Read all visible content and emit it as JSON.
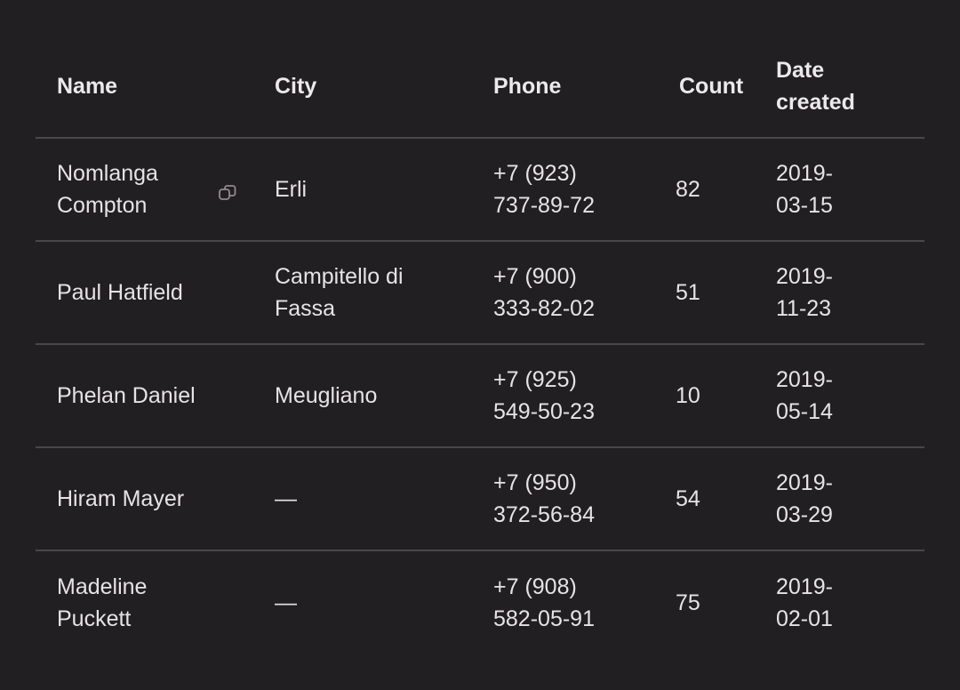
{
  "table": {
    "headers": {
      "name": "Name",
      "city": "City",
      "phone": "Phone",
      "count": "Count",
      "date_line1": "Date",
      "date_line2": "created"
    },
    "rows": [
      {
        "name_line1": "Nomlanga",
        "name_line2": "Compton",
        "city_line1": "Erli",
        "city_line2": "",
        "phone_line1": "+7 (923)",
        "phone_line2": "737-89-72",
        "count": "82",
        "date_line1": "2019-",
        "date_line2": "03-15",
        "copy_icon": "copy-icon"
      },
      {
        "name_line1": "Paul Hatfield",
        "name_line2": "",
        "city_line1": "Campitello di",
        "city_line2": "Fassa",
        "phone_line1": "+7 (900)",
        "phone_line2": "333-82-02",
        "count": "51",
        "date_line1": "2019-",
        "date_line2": "11-23"
      },
      {
        "name_line1": "Phelan Daniel",
        "name_line2": "",
        "city_line1": "Meugliano",
        "city_line2": "",
        "phone_line1": "+7 (925)",
        "phone_line2": "549-50-23",
        "count": "10",
        "date_line1": "2019-",
        "date_line2": "05-14"
      },
      {
        "name_line1": "Hiram Mayer",
        "name_line2": "",
        "city_line1": "—",
        "city_line2": "",
        "phone_line1": "+7 (950)",
        "phone_line2": "372-56-84",
        "count": "54",
        "date_line1": "2019-",
        "date_line2": "03-29"
      },
      {
        "name_line1": "Madeline",
        "name_line2": "Puckett",
        "city_line1": "—",
        "city_line2": "",
        "phone_line1": "+7 (908)",
        "phone_line2": "582-05-91",
        "count": "75",
        "date_line1": "2019-",
        "date_line2": "02-01"
      }
    ]
  },
  "colors": {
    "background": "#221f22",
    "text": "#e6e3e6",
    "divider": "#4a474a"
  }
}
